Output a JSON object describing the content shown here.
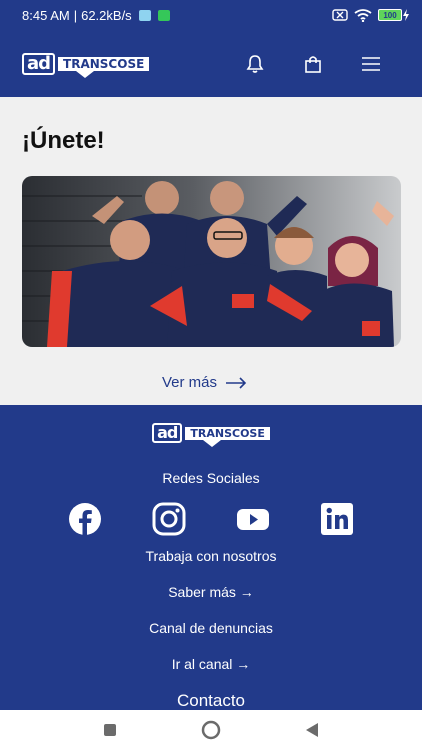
{
  "status_bar": {
    "time": "8:45 AM",
    "separator": "|",
    "net_speed": "62.2kB/s",
    "battery": "100"
  },
  "brand": {
    "logo_left": "ad",
    "logo_right": "TRANSCOSE"
  },
  "main": {
    "title": "¡Únete!",
    "hero_alt": "Grupo de empleados",
    "ver_mas": "Ver más"
  },
  "footer": {
    "redes_label": "Redes Sociales",
    "socials": [
      "facebook-icon",
      "instagram-icon",
      "youtube-icon",
      "linkedin-icon"
    ],
    "trabaja": "Trabaja con nosotros",
    "saber_mas": "Saber más →",
    "canal": "Canal de denuncias",
    "ir_canal": "Ir al canal →",
    "contacto": "Contacto"
  },
  "colors": {
    "primary": "#223a8a",
    "accent": "#e03a2e",
    "background": "#f0f0f0"
  }
}
